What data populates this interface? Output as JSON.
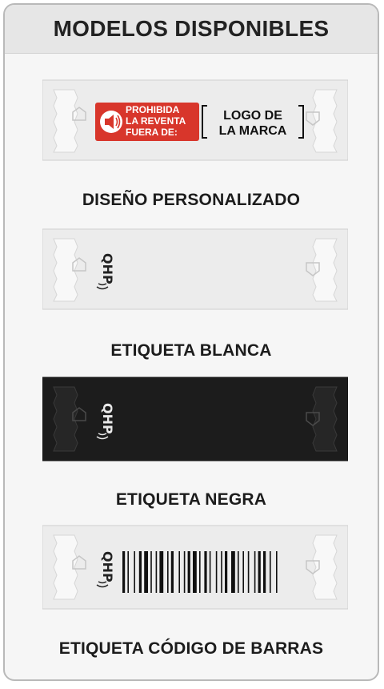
{
  "header": {
    "title": "MODELOS DISPONIBLES"
  },
  "models": [
    {
      "caption": "DISEÑO PERSONALIZADO",
      "color": "white",
      "print": {
        "warning_lines": [
          "PROHIBIDA",
          "LA REVENTA",
          "FUERA DE:"
        ],
        "warning_color": "#d8362b",
        "brand_lines": [
          "LOGO DE",
          "LA MARCA"
        ]
      }
    },
    {
      "caption": "ETIQUETA BLANCA",
      "color": "white",
      "logo": "QHP"
    },
    {
      "caption": "ETIQUETA NEGRA",
      "color": "black",
      "logo": "QHP"
    },
    {
      "caption": "ETIQUETA CÓDIGO DE BARRAS",
      "color": "white",
      "logo": "QHP",
      "barcode": true
    }
  ],
  "colors": {
    "tag_white": "#efefef",
    "tag_black": "#1a1a1a",
    "accent_red": "#d8362b"
  }
}
